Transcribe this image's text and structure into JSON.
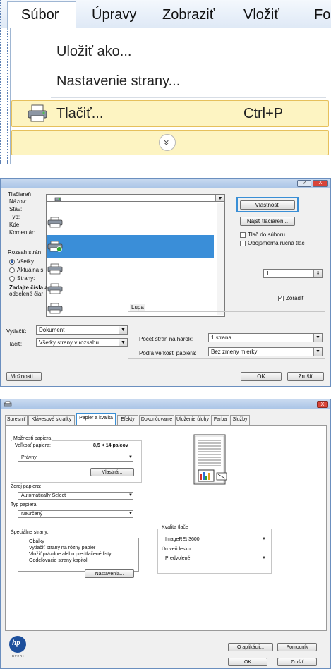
{
  "menu": {
    "items": [
      "Súbor",
      "Úpravy",
      "Zobraziť",
      "Vložiť",
      "Fo"
    ],
    "dropdown": {
      "save_as": "Uložiť ako...",
      "page_setup": "Nastavenie strany...",
      "print": "Tlačiť...",
      "print_shortcut": "Ctrl+P",
      "more": "»"
    }
  },
  "print_dialog": {
    "title_buttons": {
      "help": "?",
      "close": "X"
    },
    "printer_group": "Tlačiareň",
    "name_label": "Názov:",
    "status_label": "Stav:",
    "type_label": "Typ:",
    "where_label": "Kde:",
    "comment_label": "Komentár:",
    "properties_button": "Vlastnosti",
    "find_printer_button": "Nájsť tlačiareň...",
    "print_to_file": "Tlač do súboru",
    "duplex": "Obojsmerná ručná tlač",
    "range_group": "Rozsah strán",
    "range_all": "Všetky",
    "range_current": "Aktuálna s",
    "range_pages": "Strany:",
    "range_hint_1": "Zadajte čísla a",
    "range_hint_2": "oddelené čiar",
    "copies_value": "1",
    "collate": "Zoradiť",
    "zoom_group": "Lupa",
    "print_what_label": "Vytlačiť:",
    "print_what_value": "Dokument",
    "print_label": "Tlačiť:",
    "print_value": "Všetky strany v rozsahu",
    "pages_per_sheet_label": "Počet strán na hárok:",
    "pages_per_sheet_value": "1 strana",
    "scale_label": "Podľa veľkosti papiera:",
    "scale_value": "Bez zmeny mierky",
    "options_button": "Možnosti...",
    "ok_button": "OK",
    "cancel_button": "Zrušiť"
  },
  "properties_dialog": {
    "close": "X",
    "tabs": [
      "Spresniť",
      "Klávesové skratky",
      "Papier a kvalita",
      "Efekty",
      "Dokončovanie",
      "Uloženie úlohy",
      "Farba",
      "Služby"
    ],
    "paper_options": "Možnosti papiera",
    "paper_size_label": "Veľkosť papiera:",
    "paper_size_value": "8,5 × 14 palcov",
    "paper_size_combo": "Právny",
    "custom_button": "Vlastná...",
    "source_label": "Zdroj papiera:",
    "source_value": "Automatically Select",
    "type_label": "Typ papiera:",
    "type_value": "Neurčený",
    "special_label": "Špeciálne strany:",
    "special_items": [
      "Obálky",
      "Vytlačiť strany na rôzny papier",
      "Vložiť prázdne alebo predtlačené listy",
      "Oddeľovacie strany kapitol"
    ],
    "settings_button": "Nastavenia...",
    "quality_group": "Kvalita tlače",
    "quality_value": "ImageREt 3600",
    "gloss_label": "Úroveň lesku:",
    "gloss_value": "Predvolené",
    "brand_text": "invent",
    "about_button": "O aplikácii...",
    "help_button": "Pomocník",
    "ok_button": "OK",
    "cancel_button": "Zrušiť"
  }
}
